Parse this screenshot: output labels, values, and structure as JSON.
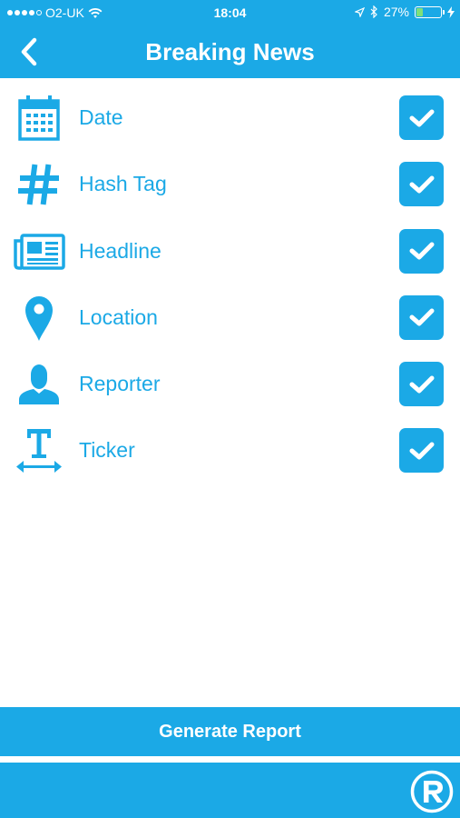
{
  "status_bar": {
    "carrier": "O2-UK",
    "time": "18:04",
    "battery_percent": "27%",
    "battery_level": 0.27
  },
  "navbar": {
    "title": "Breaking News",
    "back_icon": "chevron-left-icon"
  },
  "items": [
    {
      "label": "Date",
      "icon": "calendar-icon",
      "checked": true
    },
    {
      "label": "Hash Tag",
      "icon": "hashtag-icon",
      "checked": true
    },
    {
      "label": "Headline",
      "icon": "newspaper-icon",
      "checked": true
    },
    {
      "label": "Location",
      "icon": "location-pin-icon",
      "checked": true
    },
    {
      "label": "Reporter",
      "icon": "person-icon",
      "checked": true
    },
    {
      "label": "Ticker",
      "icon": "ticker-text-icon",
      "checked": true
    }
  ],
  "actions": {
    "generate_label": "Generate Report"
  },
  "footer": {
    "logo_icon": "app-logo-icon"
  },
  "colors": {
    "accent": "#1ba9e6",
    "background": "#ffffff",
    "battery_fill": "#7ee07a"
  }
}
